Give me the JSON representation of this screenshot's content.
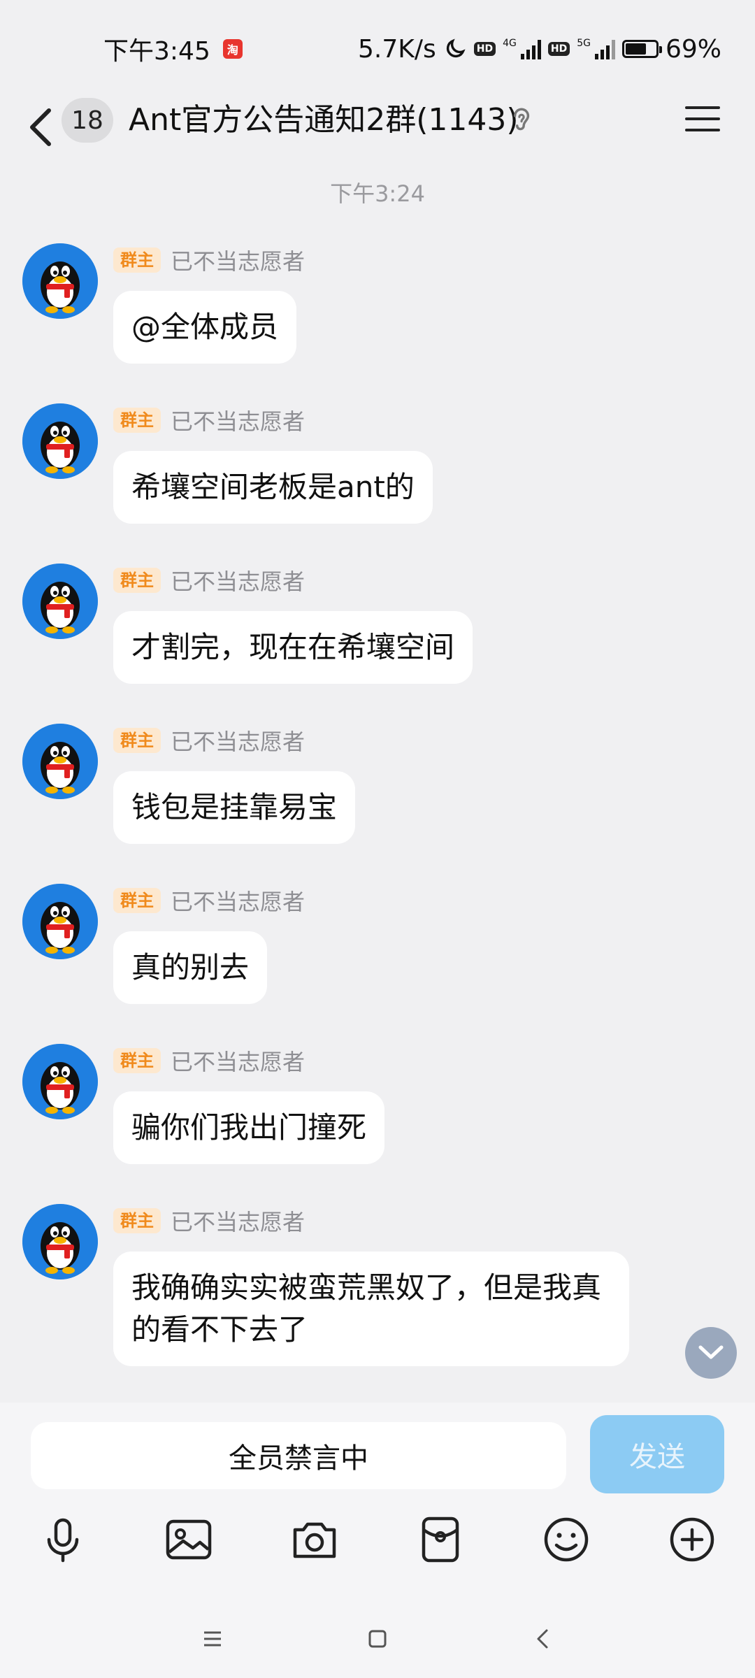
{
  "status_bar": {
    "time": "下午3:45",
    "speed": "5.7K/s",
    "network1": "4G",
    "network2": "5G",
    "hd_badge": "HD",
    "battery_text": "69%",
    "battery_level": 0.69
  },
  "header": {
    "unread_count": "18",
    "title": "Ant官方公告通知2群(1143)"
  },
  "timestamp": "下午3:24",
  "messages": [
    {
      "role": "群主",
      "sender": "已不当志愿者",
      "text": "@全体成员"
    },
    {
      "role": "群主",
      "sender": "已不当志愿者",
      "text": "希壤空间老板是ant的"
    },
    {
      "role": "群主",
      "sender": "已不当志愿者",
      "text": "才割完，现在在希壤空间"
    },
    {
      "role": "群主",
      "sender": "已不当志愿者",
      "text": "钱包是挂靠易宝"
    },
    {
      "role": "群主",
      "sender": "已不当志愿者",
      "text": "真的别去"
    },
    {
      "role": "群主",
      "sender": "已不当志愿者",
      "text": "骗你们我出门撞死"
    },
    {
      "role": "群主",
      "sender": "已不当志愿者",
      "text": "我确确实实被蛮荒黑奴了，但是我真的看不下去了"
    }
  ],
  "input": {
    "placeholder": "全员禁言中",
    "send_label": "发送"
  },
  "toolbar": [
    "microphone-icon",
    "image-icon",
    "camera-icon",
    "red-packet-icon",
    "emoji-icon",
    "plus-icon"
  ],
  "colors": {
    "background": "#f0f0f2",
    "badge_bg": "#fde8cf",
    "badge_text": "#f08a1c",
    "send_button": "#8ccbf3",
    "avatar_bg": "#1f7fe0"
  }
}
